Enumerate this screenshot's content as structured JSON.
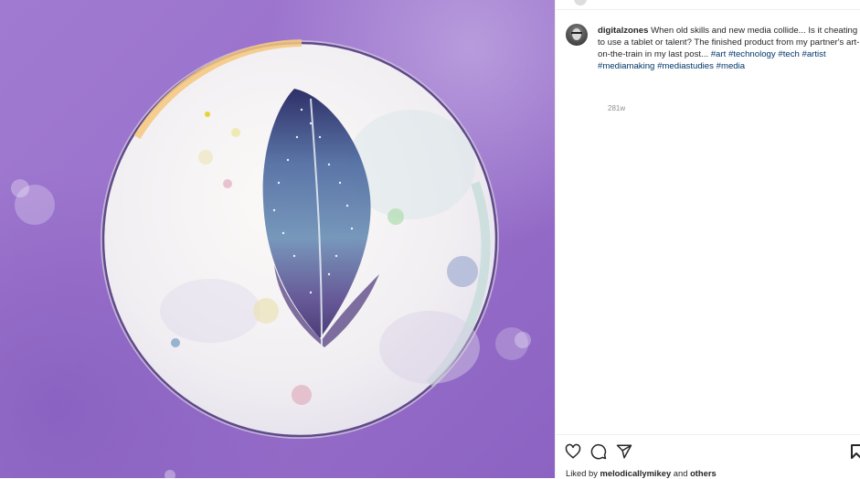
{
  "post": {
    "username": "digitalzones",
    "caption_text": "When old skills and new media collide... Is it cheating to use a tablet or talent? The finished product from my partner's art-on-the-train in my last post...",
    "hashtags": [
      "#art",
      "#technology",
      "#tech",
      "#artist",
      "#mediamaking",
      "#mediastudies",
      "#media"
    ],
    "timestamp": "281w"
  },
  "actions": {
    "like_icon": "heart-icon",
    "comment_icon": "comment-icon",
    "share_icon": "share-icon",
    "save_icon": "bookmark-icon"
  },
  "likes": {
    "prefix": "Liked by",
    "user": "melodicallymikey",
    "conjunction": "and",
    "others": "others"
  },
  "colors": {
    "background_purple": "#9a72cc",
    "hashtag": "#00376b",
    "text": "#262626",
    "muted": "#8e8e8e"
  }
}
